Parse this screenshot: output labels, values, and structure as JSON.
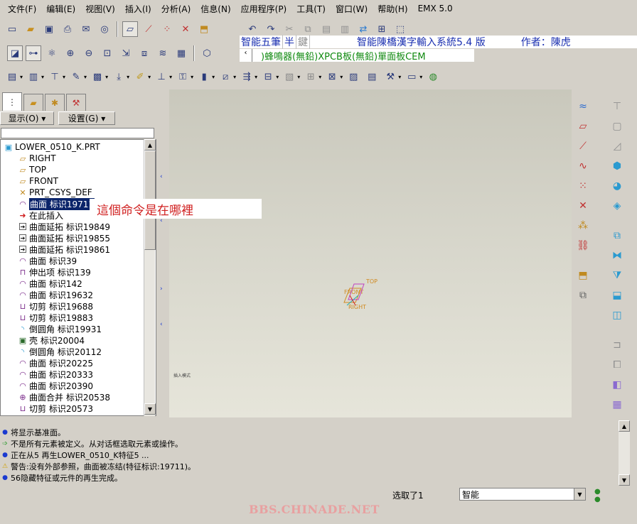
{
  "menubar": {
    "items": [
      "文件(F)",
      "编辑(E)",
      "视图(V)",
      "插入(I)",
      "分析(A)",
      "信息(N)",
      "应用程序(P)",
      "工具(T)",
      "窗口(W)",
      "帮助(H)",
      "EMX 5.0"
    ]
  },
  "ime": {
    "mode": "智能五筆",
    "half": "半",
    "key": "鍵",
    "title": "智能陳橋漢字輸入系統5.4 版",
    "author": "作者：陳虎",
    "line2": ")蜂鳴器(無鉛)XPCB板(無鉛)單面板CEM"
  },
  "panel": {
    "show_button": "显示(O) ▾",
    "settings_button": "设置(G) ▾"
  },
  "tree": {
    "root": "LOWER_0510_K.PRT",
    "items": [
      {
        "label": "RIGHT",
        "icon": "datum-plane-icon"
      },
      {
        "label": "TOP",
        "icon": "datum-plane-icon"
      },
      {
        "label": "FRONT",
        "icon": "datum-plane-icon"
      },
      {
        "label": "PRT_CSYS_DEF",
        "icon": "csys-icon"
      },
      {
        "label": "曲面 标识19711",
        "icon": "surface-icon"
      },
      {
        "label": "在此插入",
        "icon": "insert-arrow-icon"
      },
      {
        "label": "曲面延拓 标识19849",
        "icon": "extend-icon"
      },
      {
        "label": "曲面延拓 标识19855",
        "icon": "extend-icon"
      },
      {
        "label": "曲面延拓 标识19861",
        "icon": "extend-icon"
      },
      {
        "label": "曲面 标识39",
        "icon": "surface-icon"
      },
      {
        "label": "伸出项 标识139",
        "icon": "protrusion-icon"
      },
      {
        "label": "曲面 标识142",
        "icon": "surface-icon"
      },
      {
        "label": "曲面 标识19632",
        "icon": "surface-icon"
      },
      {
        "label": "切剪 标识19688",
        "icon": "cut-icon"
      },
      {
        "label": "切剪 标识19883",
        "icon": "cut-icon"
      },
      {
        "label": "倒圆角 标识19931",
        "icon": "round-icon"
      },
      {
        "label": "壳 标识20004",
        "icon": "shell-icon"
      },
      {
        "label": "倒圆角 标识20112",
        "icon": "round-icon"
      },
      {
        "label": "曲面 标识20225",
        "icon": "surface-icon"
      },
      {
        "label": "曲面 标识20333",
        "icon": "surface-icon"
      },
      {
        "label": "曲面 标识20390",
        "icon": "surface-icon"
      },
      {
        "label": "曲面合并 标识20538",
        "icon": "merge-icon"
      },
      {
        "label": "切剪 标识20573",
        "icon": "cut-icon"
      }
    ]
  },
  "callout": "這個命令是在哪裡",
  "graphics": {
    "small_note": "插入模式",
    "datum_top": "TOP",
    "datum_front": "FRONT",
    "datum_right": "RIGHT"
  },
  "messages": [
    {
      "text": "将显示基准面。",
      "icon": "info-dot-icon",
      "color": "#1a3ad0"
    },
    {
      "text": "不是所有元素被定义。从对话框选取元素或操作。",
      "icon": "prompt-arrow-icon",
      "color": "#2a9a2a"
    },
    {
      "text": "正在从5 再生LOWER_0510_K特征5 ...",
      "icon": "info-dot-icon",
      "color": "#1a3ad0"
    },
    {
      "text": "警告:没有外部参照，曲面被冻结(特征标识:19711)。",
      "icon": "warning-icon",
      "color": "#d0a000"
    },
    {
      "text": "56隐藏特征或元件的再生完成。",
      "icon": "info-dot-icon",
      "color": "#1a3ad0"
    }
  ],
  "status": {
    "selected": "选取了1",
    "filter": "智能"
  },
  "watermark": "BBS.CHINADE.NET"
}
